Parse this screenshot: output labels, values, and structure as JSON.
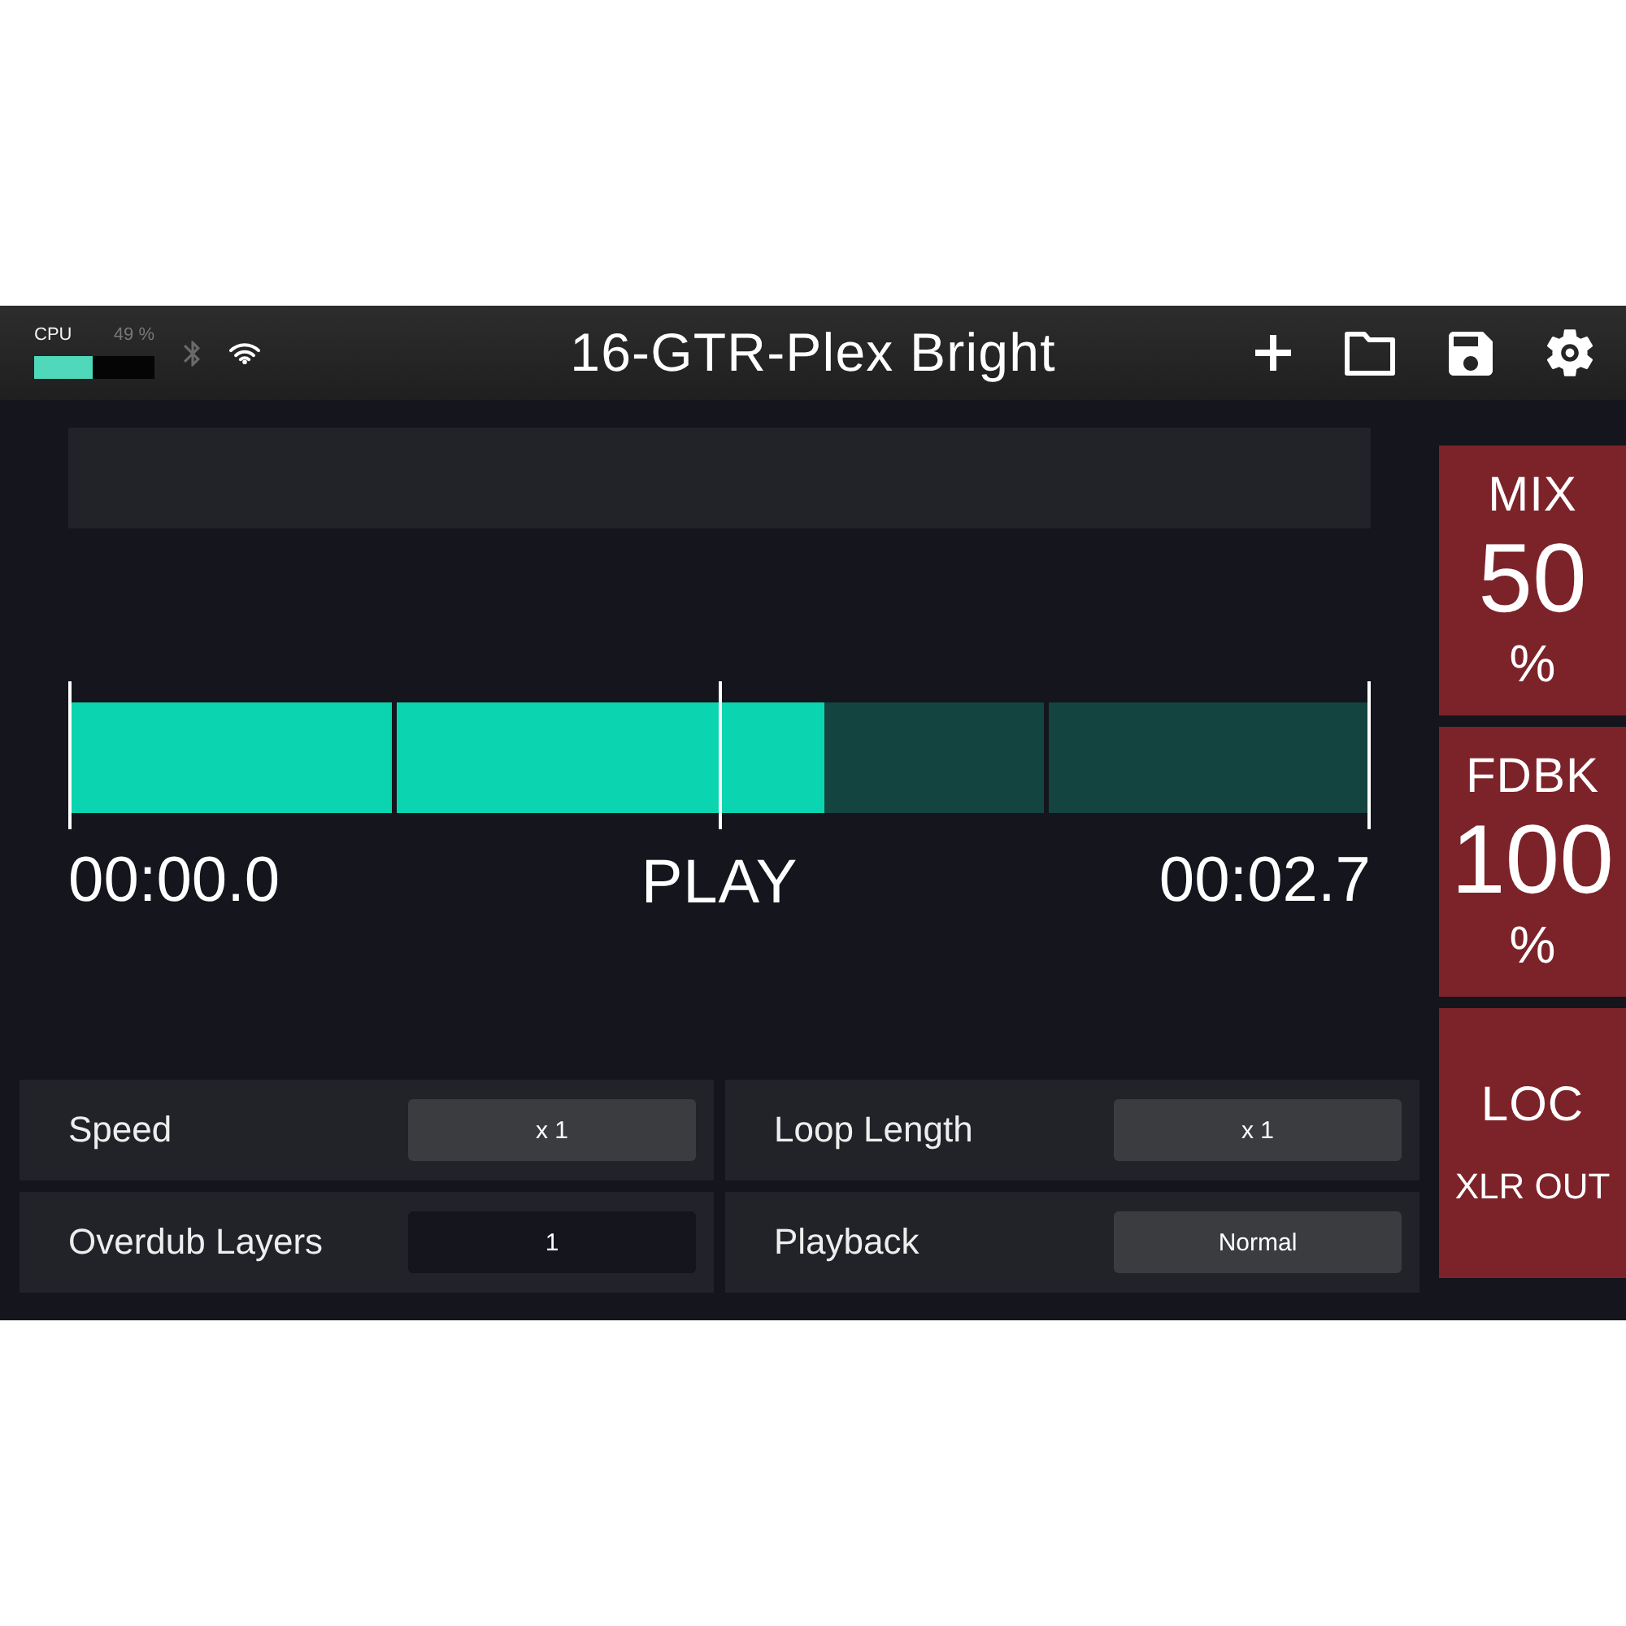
{
  "status_bar": {
    "cpu": {
      "label": "CPU",
      "reading": "49 %",
      "level": 0.49
    },
    "bluetooth": {
      "on": false
    },
    "wifi": {
      "on": true
    }
  },
  "preset_title": "16-GTR-Plex Bright",
  "loop": {
    "level": 0.58,
    "start_time": "00:00.0",
    "status": "PLAY",
    "end_time": "00:02.7"
  },
  "settings": [
    {
      "label": "Speed",
      "value": "x 1",
      "kind": "selector"
    },
    {
      "label": "Loop Length",
      "value": "x 1",
      "kind": "selector"
    },
    {
      "label": "Overdub Layers",
      "value": "1",
      "kind": "input"
    },
    {
      "label": "Playback",
      "value": "Normal",
      "kind": "selector"
    }
  ],
  "controls": [
    {
      "kind": "parameter",
      "label": "MIX",
      "value": "50",
      "unit": "%"
    },
    {
      "kind": "parameter",
      "label": "FDBK",
      "value": "100",
      "unit": "%"
    },
    {
      "kind": "routing",
      "label": "LOC",
      "detail": "XLR OUT"
    }
  ]
}
